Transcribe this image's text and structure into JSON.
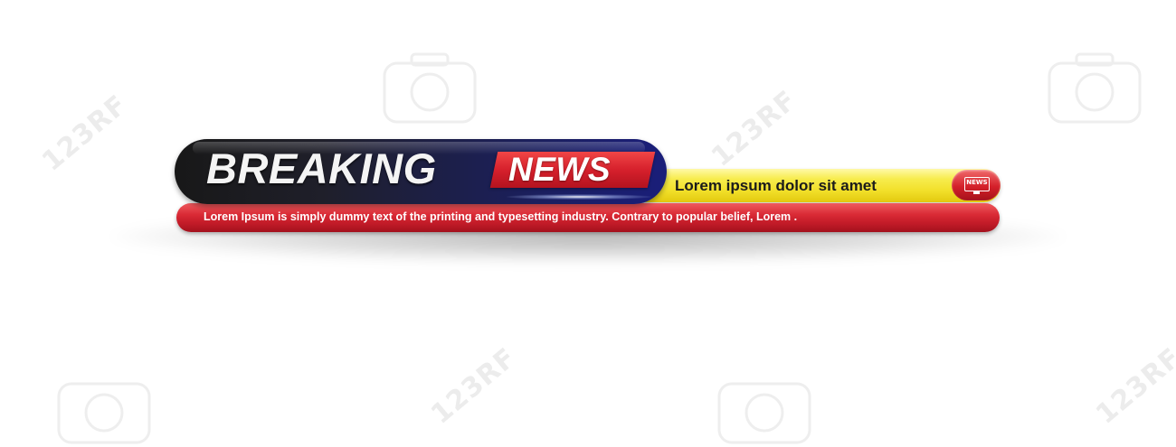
{
  "banner": {
    "breaking_label": "BREAKING",
    "news_label": "NEWS",
    "headline": "Lorem ipsum dolor sit amet",
    "badge_label": "NEWS",
    "ticker": "Lorem Ipsum is simply dummy text of the printing and typesetting industry. Contrary to popular belief, Lorem ."
  },
  "watermark": {
    "text": "123RF"
  },
  "colors": {
    "dark_bar": "#1b1f5a",
    "red_accent": "#d6202c",
    "yellow_bar": "#f2e02a",
    "background": "#ffffff"
  },
  "icons": {
    "badge_icon": "tv-monitor-icon"
  }
}
